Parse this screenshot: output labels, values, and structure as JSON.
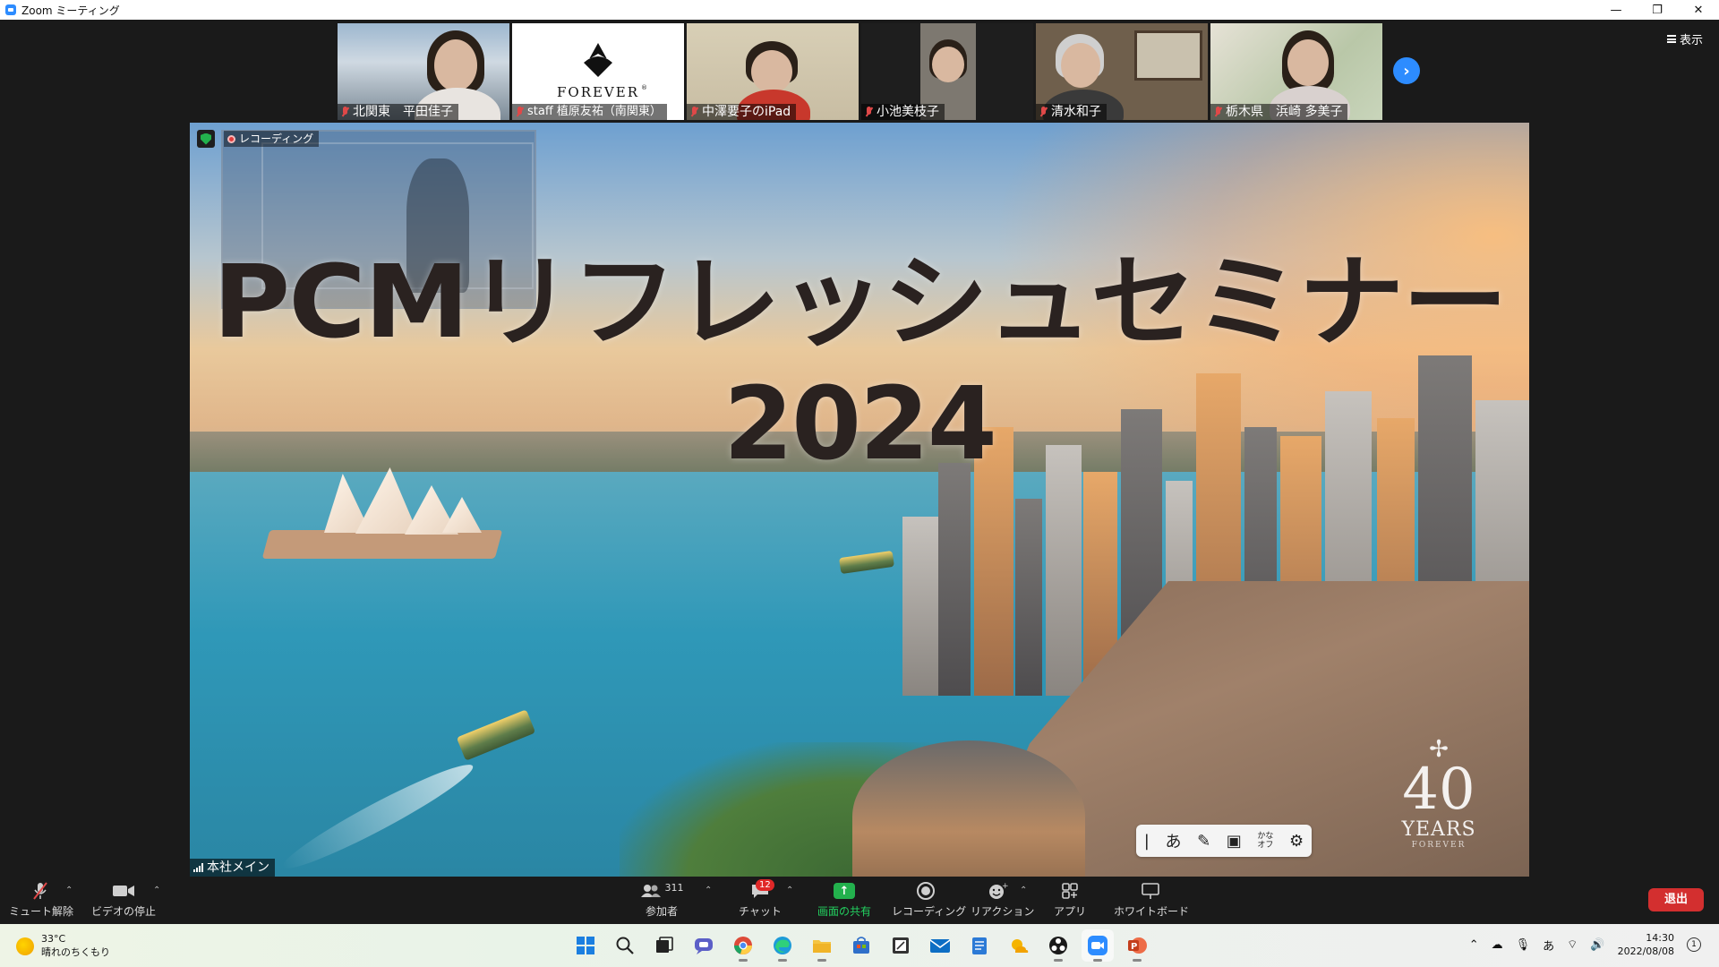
{
  "window": {
    "title": "Zoom ミーティング",
    "controls": [
      "—",
      "❐",
      "✕"
    ]
  },
  "view_button": {
    "label": "表示"
  },
  "participants": [
    {
      "name": "北関東　平田佳子"
    },
    {
      "name": "staff 植原友祐（南関東）"
    },
    {
      "name": "中澤要子のiPad"
    },
    {
      "name": "小池美枝子"
    },
    {
      "name": "清水和子"
    },
    {
      "name": "栃木県　浜崎 多美子"
    }
  ],
  "forever_logo": {
    "text": "FOREVER",
    "mark": "®"
  },
  "next_page_icon": "chevron-right-icon",
  "recording": {
    "label": "レコーディング"
  },
  "slide": {
    "title_line1": "PCMリフレッシュセミナー",
    "title_line2": "2024",
    "anniversary_number": "40",
    "anniversary_text": "YEARS",
    "anniversary_brand": "FOREVER"
  },
  "host_label": "本社メイン",
  "ime_toolbar": {
    "cursor": "|",
    "hiragana": "あ",
    "kana_toggle_top": "かな",
    "kana_toggle_bottom": "オフ"
  },
  "toolbar": {
    "mute": "ミュート解除",
    "video": "ビデオの停止",
    "participants": "参加者",
    "participant_count": "311",
    "chat": "チャット",
    "chat_badge": "12",
    "share": "画面の共有",
    "record": "レコーディング",
    "reactions": "リアクション",
    "apps": "アプリ",
    "whiteboard": "ホワイトボード",
    "end": "退出"
  },
  "taskbar": {
    "temperature": "33°C",
    "weather": "晴れのちくもり",
    "ime": "あ",
    "time": "14:30",
    "date": "2022/08/08",
    "notifications": "1"
  },
  "colors": {
    "zoom_blue": "#2d8cff",
    "end_red": "#d32f2f",
    "share_green": "#23b14d"
  }
}
